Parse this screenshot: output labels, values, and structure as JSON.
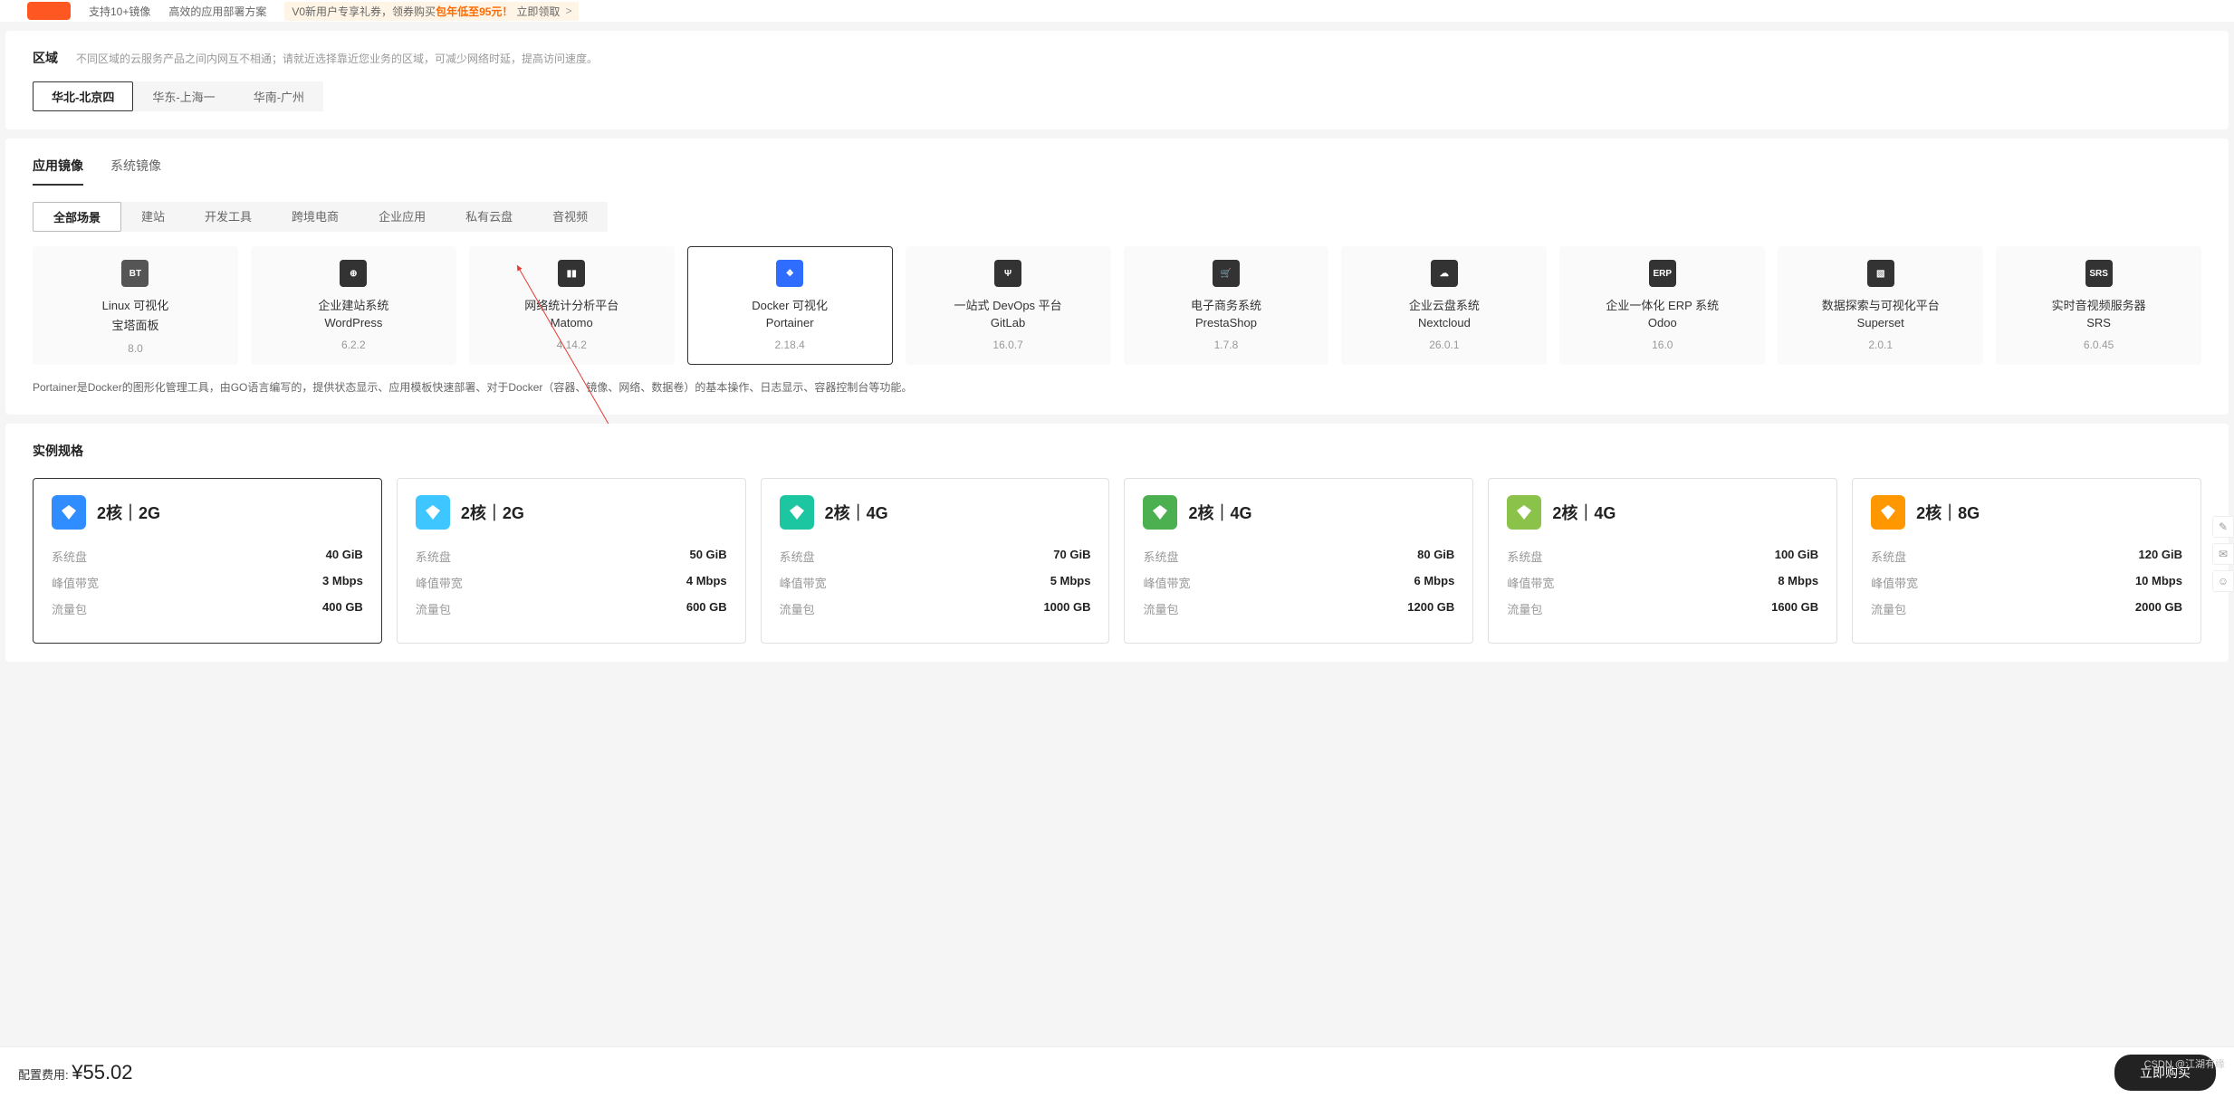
{
  "topbar": {
    "t1": "支持10+镜像",
    "t2": "高效的应用部署方案",
    "promo_pre": "V0新用户专享礼券，领券购买 ",
    "promo_hl": "包年低至95元！",
    "promo_link": "立即领取",
    "promo_arrow": ">"
  },
  "region": {
    "label": "区域",
    "desc": "不同区域的云服务产品之间内网互不相通；请就近选择靠近您业务的区域，可减少网络时延，提高访问速度。",
    "tabs": [
      "华北-北京四",
      "华东-上海一",
      "华南-广州"
    ],
    "selected": 0
  },
  "image": {
    "tabs": [
      "应用镜像",
      "系统镜像"
    ],
    "selected_tab": 0,
    "scenes": [
      "全部场景",
      "建站",
      "开发工具",
      "跨境电商",
      "企业应用",
      "私有云盘",
      "音视频"
    ],
    "selected_scene": 0,
    "cards": [
      {
        "icon_text": "BT",
        "icon_bg": "#555",
        "title": "Linux 可视化",
        "sub": "宝塔面板",
        "ver": "8.0"
      },
      {
        "icon_text": "",
        "icon_bg": "#333",
        "icon_glyph": "⊕",
        "title": "企业建站系统",
        "sub": "WordPress",
        "ver": "6.2.2"
      },
      {
        "icon_text": "",
        "icon_bg": "#333",
        "icon_glyph": "▮▮",
        "title": "网络统计分析平台",
        "sub": "Matomo",
        "ver": "4.14.2"
      },
      {
        "icon_text": "",
        "icon_bg": "#2f6dff",
        "icon_glyph": "❖",
        "title": "Docker 可视化",
        "sub": "Portainer",
        "ver": "2.18.4",
        "selected": true
      },
      {
        "icon_text": "",
        "icon_bg": "#333",
        "icon_glyph": "Ψ",
        "title": "一站式 DevOps 平台",
        "sub": "GitLab",
        "ver": "16.0.7"
      },
      {
        "icon_text": "",
        "icon_bg": "#333",
        "icon_glyph": "🛒",
        "title": "电子商务系统",
        "sub": "PrestaShop",
        "ver": "1.7.8"
      },
      {
        "icon_text": "",
        "icon_bg": "#333",
        "icon_glyph": "☁",
        "title": "企业云盘系统",
        "sub": "Nextcloud",
        "ver": "26.0.1"
      },
      {
        "icon_text": "ERP",
        "icon_bg": "#333",
        "title": "企业一体化 ERP 系统",
        "sub": "Odoo",
        "ver": "16.0"
      },
      {
        "icon_text": "",
        "icon_bg": "#333",
        "icon_glyph": "▧",
        "title": "数据探索与可视化平台",
        "sub": "Superset",
        "ver": "2.0.1"
      },
      {
        "icon_text": "SRS",
        "icon_bg": "#333",
        "title": "实时音视频服务器",
        "sub": "SRS",
        "ver": "6.0.45"
      }
    ],
    "desc": "Portainer是Docker的图形化管理工具，由GO语言编写的，提供状态显示、应用模板快速部署、对于Docker（容器、镜像、网络、数据卷）的基本操作、日志显示、容器控制台等功能。"
  },
  "spec": {
    "title": "实例规格",
    "rows_k": {
      "disk": "系统盘",
      "bw": "峰值带宽",
      "traffic": "流量包"
    },
    "items": [
      {
        "name": "2核｜2G",
        "color": "#2f8dff",
        "disk": "40 GiB",
        "bw": "3 Mbps",
        "traffic": "400 GB",
        "selected": true
      },
      {
        "name": "2核｜2G",
        "color": "#3dc6ff",
        "disk": "50 GiB",
        "bw": "4 Mbps",
        "traffic": "600 GB"
      },
      {
        "name": "2核｜4G",
        "color": "#1cc6a1",
        "disk": "70 GiB",
        "bw": "5 Mbps",
        "traffic": "1000 GB"
      },
      {
        "name": "2核｜4G",
        "color": "#4caf50",
        "disk": "80 GiB",
        "bw": "6 Mbps",
        "traffic": "1200 GB"
      },
      {
        "name": "2核｜4G",
        "color": "#8bc34a",
        "disk": "100 GiB",
        "bw": "8 Mbps",
        "traffic": "1600 GB"
      },
      {
        "name": "2核｜8G",
        "color": "#ff9800",
        "disk": "120 GiB",
        "bw": "10 Mbps",
        "traffic": "2000 GB"
      }
    ]
  },
  "footer": {
    "label": "配置费用: ",
    "price": "¥55.02",
    "buy": "立即购买"
  },
  "watermark": "CSDN @江湖有缘"
}
